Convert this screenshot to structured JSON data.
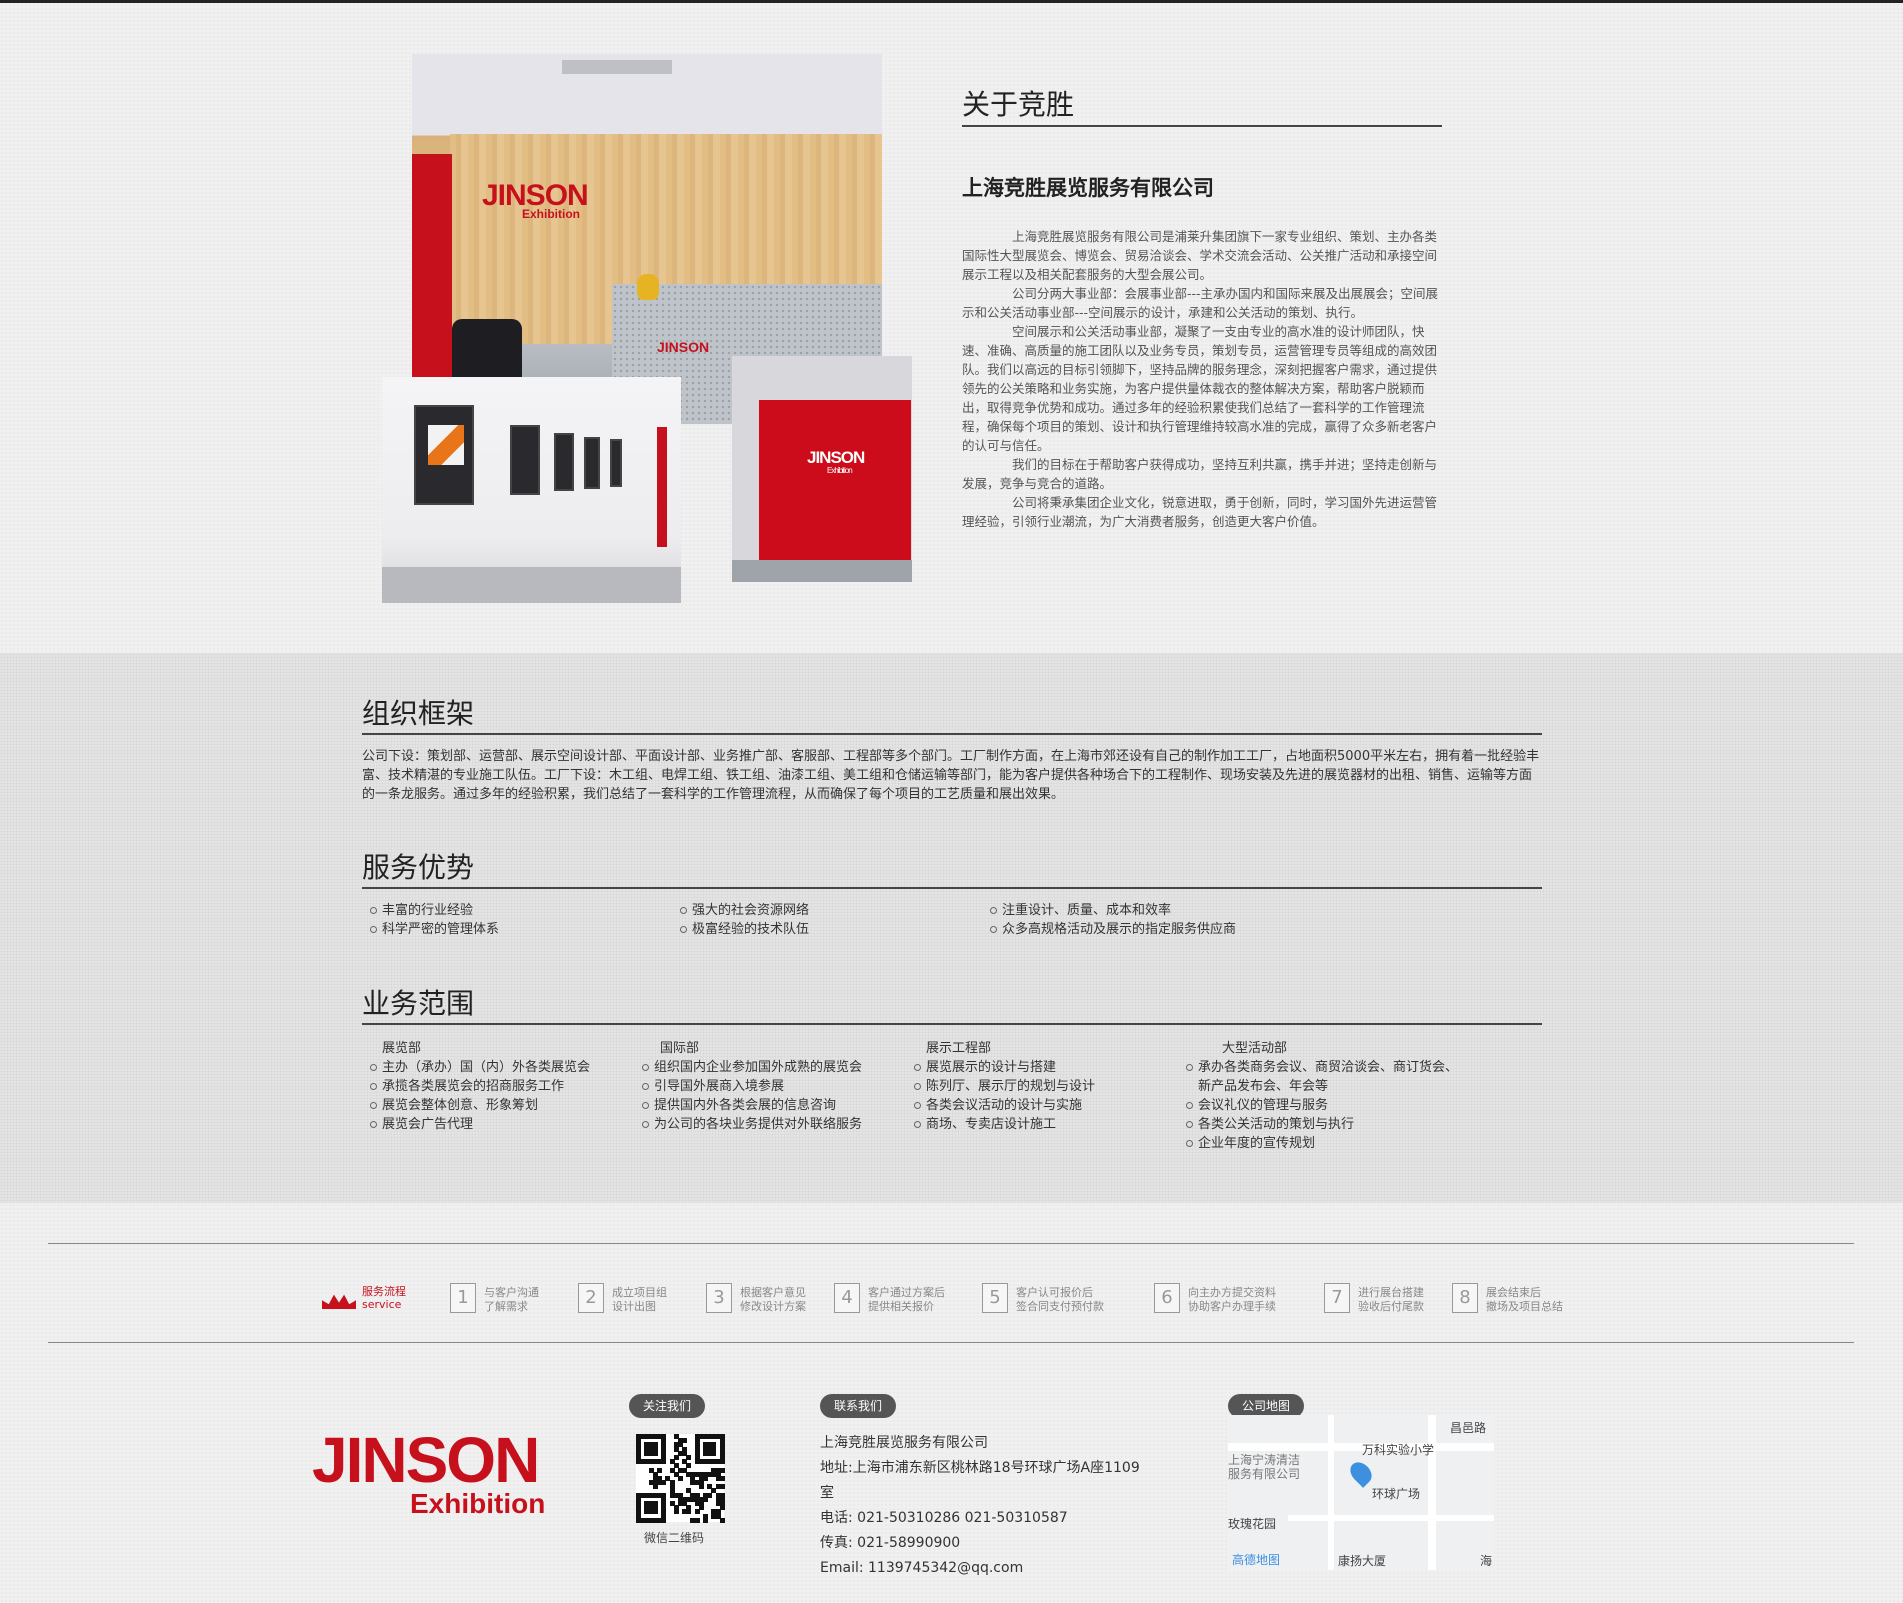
{
  "about": {
    "title": "关于竞胜",
    "company_name": "上海竞胜展览服务有限公司",
    "paragraphs": [
      "上海竞胜展览服务有限公司是浦莱升集团旗下一家专业组织、策划、主办各类国际性大型展览会、博览会、贸易洽谈会、学术交流会活动、公关推广活动和承接空间展示工程以及相关配套服务的大型会展公司。",
      "公司分两大事业部：会展事业部---主承办国内和国际来展及出展展会；空间展示和公关活动事业部---空间展示的设计，承建和公关活动的策划、执行。",
      "空间展示和公关活动事业部，凝聚了一支由专业的高水准的设计师团队，快速、准确、高质量的施工团队以及业务专员，策划专员，运营管理专员等组成的高效团队。我们以高远的目标引领脚下，坚持品牌的服务理念，深刻把握客户需求，通过提供领先的公关策略和业务实施，为客户提供量体裁衣的整体解决方案，帮助客户脱颖而出，取得竞争优势和成功。通过多年的经验积累使我们总结了一套科学的工作管理流程，确保每个项目的策划、设计和执行管理维持较高水准的完成，赢得了众多新老客户的认可与信任。",
      "我们的目标在于帮助客户获得成功，坚持互利共赢，携手并进；坚持走创新与发展，竞争与竞合的道路。",
      "公司将秉承集团企业文化，锐意进取，勇于创新，同时，学习国外先进运营管理经验，引领行业潮流，为广大消费者服务，创造更大客户价值。"
    ],
    "photo_logo_text": "JINSON",
    "photo_logo_sub": "Exhibition"
  },
  "org": {
    "title": "组织框架",
    "body": "公司下设：策划部、运营部、展示空间设计部、平面设计部、业务推广部、客服部、工程部等多个部门。工厂制作方面，在上海市郊还设有自己的制作加工工厂，占地面积5000平米左右，拥有着一批经验丰富、技术精湛的专业施工队伍。工厂下设：木工组、电焊工组、铁工组、油漆工组、美工组和仓储运输等部门，能为客户提供各种场合下的工程制作、现场安装及先进的展览器材的出租、销售、运输等方面的一条龙服务。通过多年的经验积累，我们总结了一套科学的工作管理流程，从而确保了每个项目的工艺质量和展出效果。"
  },
  "advantages": {
    "title": "服务优势",
    "items": [
      "丰富的行业经验",
      "强大的社会资源网络",
      "注重设计、质量、成本和效率",
      "科学严密的管理体系",
      "极富经验的技术队伍",
      "众多高规格活动及展示的指定服务供应商"
    ]
  },
  "scope": {
    "title": "业务范围",
    "columns": [
      {
        "head": "展览部",
        "items": [
          "主办（承办）国（内）外各类展览会",
          "承揽各类展览会的招商服务工作",
          "展览会整体创意、形象筹划",
          "展览会广告代理"
        ]
      },
      {
        "head": "国际部",
        "items": [
          "组织国内企业参加国外成熟的展览会",
          "引导国外展商入境参展",
          "提供国内外各类会展的信息咨询",
          "为公司的各块业务提供对外联络服务"
        ]
      },
      {
        "head": "展示工程部",
        "items": [
          "展览展示的设计与搭建",
          "陈列厅、展示厅的规划与设计",
          "各类会议活动的设计与实施",
          "商场、专卖店设计施工"
        ]
      },
      {
        "head": "大型活动部",
        "items": [
          "承办各类商务会议、商贸洽谈会、商订货会、新产品发布会、年会等",
          "会议礼仪的管理与服务",
          "各类公关活动的策划与执行",
          "企业年度的宣传规划"
        ]
      }
    ]
  },
  "process": {
    "title_cn": "服务流程",
    "title_en": "service",
    "steps": [
      {
        "num": "1",
        "line1": "与客户沟通",
        "line2": "了解需求"
      },
      {
        "num": "2",
        "line1": "成立项目组",
        "line2": "设计出图"
      },
      {
        "num": "3",
        "line1": "根据客户意见",
        "line2": "修改设计方案"
      },
      {
        "num": "4",
        "line1": "客户通过方案后",
        "line2": "提供相关报价"
      },
      {
        "num": "5",
        "line1": "客户认可报价后",
        "line2": "签合同支付预付款"
      },
      {
        "num": "6",
        "line1": "向主办方提交资料",
        "line2": "协助客户办理手续"
      },
      {
        "num": "7",
        "line1": "进行展台搭建",
        "line2": "验收后付尾款"
      },
      {
        "num": "8",
        "line1": "展会结束后",
        "line2": "撤场及项目总结"
      }
    ]
  },
  "footer": {
    "brand_big": "JINSON",
    "brand_small": "Exhibition",
    "follow_label": "关注我们",
    "qr_caption": "微信二维码",
    "contact_label": "联系我们",
    "contact": {
      "company": "上海竞胜展览服务有限公司",
      "address": "地址:上海市浦东新区桃林路18号环球广场A座1109室",
      "phone": "电话: 021-50310286 021-50310587",
      "fax": "传真: 021-58990900",
      "email": "Email: 1139745342@qq.com"
    },
    "map_label": "公司地图",
    "map": {
      "labels": [
        "昌邑路",
        "万科实验小学",
        "上海宁涛清洁",
        "服务有限公司",
        "环球广场",
        "玫瑰花园",
        "康扬大厦",
        "海"
      ],
      "provider": "高德地图"
    }
  },
  "colors": {
    "brand_red": "#c6111d",
    "pill_gray": "#555555"
  }
}
